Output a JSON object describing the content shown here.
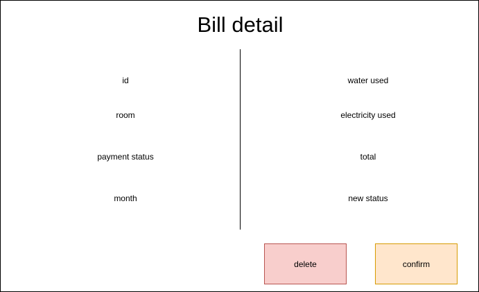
{
  "title": "Bill detail",
  "left_fields": [
    "id",
    "room",
    "payment status",
    "month"
  ],
  "right_fields": [
    "water used",
    "electricity used",
    "total",
    "new status"
  ],
  "buttons": {
    "delete_label": "delete",
    "confirm_label": "confirm"
  },
  "colors": {
    "delete_fill": "#f8cecc",
    "delete_border": "#b85450",
    "confirm_fill": "#ffe6cc",
    "confirm_border": "#d79b00"
  }
}
